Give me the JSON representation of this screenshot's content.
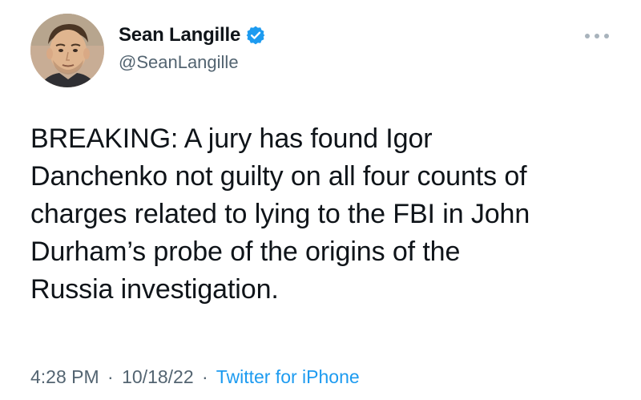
{
  "author": {
    "display_name": "Sean Langille",
    "handle": "@SeanLangille",
    "verified": true
  },
  "tweet": {
    "lines": [
      "BREAKING: A jury has found Igor",
      "Danchenko not guilty on all four counts of",
      "charges related to lying to the FBI in John",
      "Durham’s probe of the origins of the",
      "Russia investigation."
    ],
    "time": "4:28 PM",
    "date": "10/18/22",
    "separator": "·",
    "source": "Twitter for iPhone"
  },
  "icons": {
    "verified": "verified-badge-icon",
    "more": "more-options-icon"
  },
  "colors": {
    "text": "#0f1419",
    "secondary": "#536471",
    "accent": "#1d9bf0"
  }
}
